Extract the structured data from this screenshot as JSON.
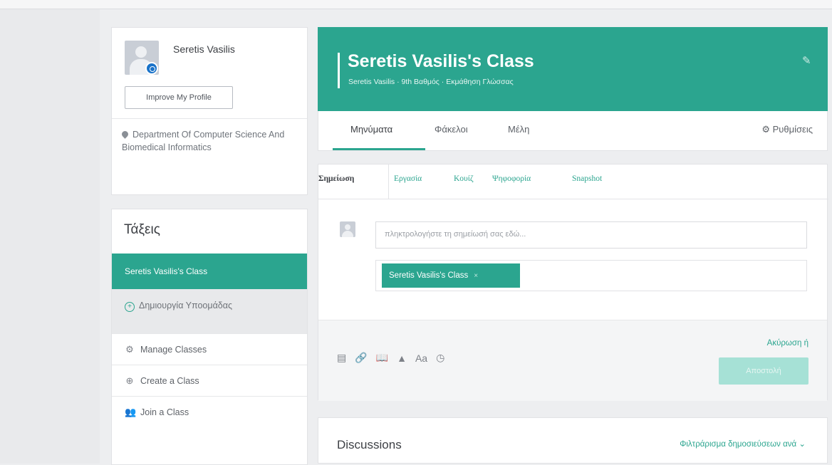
{
  "profile": {
    "name": "Seretis Vasilis",
    "improve_label": "Improve My Profile",
    "department": "Department Of Computer Science And Biomedical Informatics"
  },
  "classes": {
    "title": "Τάξεις",
    "active_class": "Seretis Vasilis's Class",
    "create_subgroup": "Δημιουργία Υποομάδας",
    "manage": "Manage Classes",
    "create": "Create a Class",
    "join": "Join a Class"
  },
  "banner": {
    "title": "Seretis Vasilis's Class",
    "subtitle": "Seretis Vasilis · 9th Βαθμός · Εκμάθηση Γλώσσας",
    "color": "#2ba58f"
  },
  "tabs": {
    "messages": "Μηνύματα",
    "folders": "Φάκελοι",
    "members": "Μέλη",
    "settings": "Ρυθμίσεις"
  },
  "composer": {
    "tabs": [
      "Σημείωση",
      "Εργασία",
      "Κουίζ",
      "Ψηφοφορία",
      "Snapshot"
    ],
    "placeholder": "πληκτρολογήστε τη σημείωσή σας εδώ...",
    "recipient": "Seretis Vasilis's Class",
    "tools": [
      "note-icon",
      "link-icon",
      "library-icon",
      "drive-icon",
      "text-format-icon",
      "clock-icon"
    ],
    "tool_text": "Aa",
    "cancel": "Ακύρωση ή",
    "send": "Αποστολή"
  },
  "discussions": {
    "title": "Discussions",
    "filter": "Φιλτράρισμα δημοσιεύσεων ανά"
  }
}
